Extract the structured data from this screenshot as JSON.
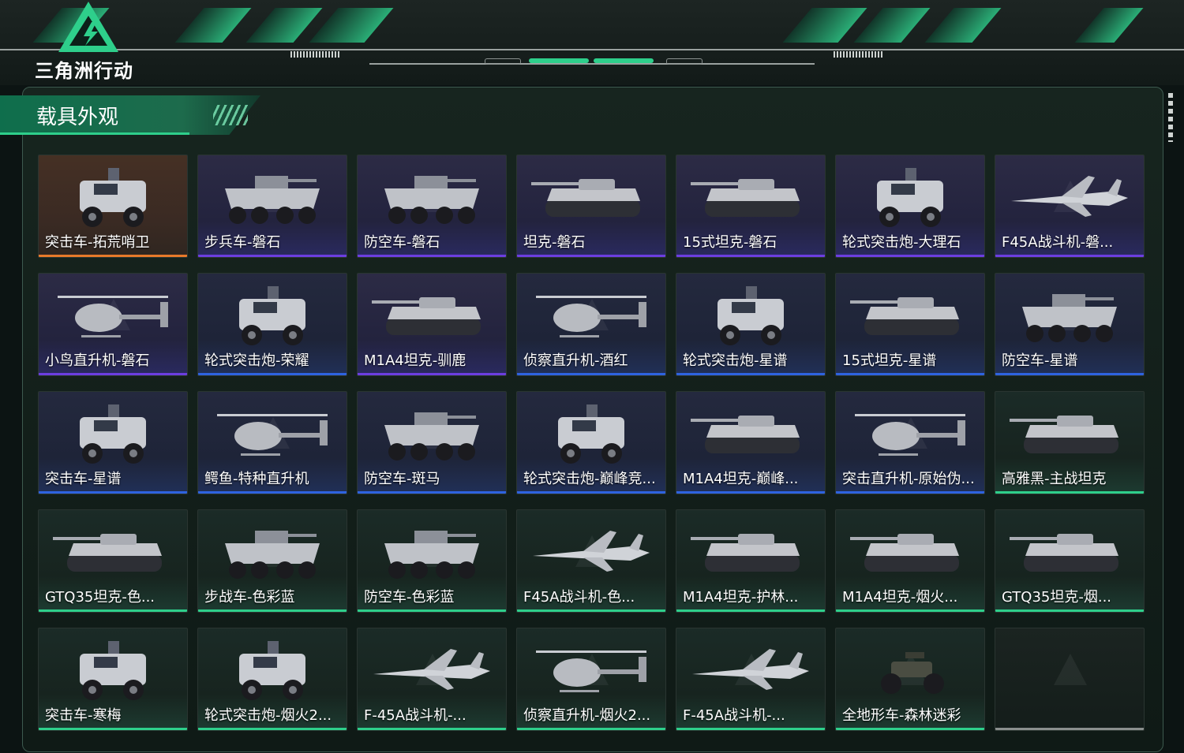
{
  "brand": {
    "title": "三角洲行动"
  },
  "section": {
    "title": "载具外观"
  },
  "colors": {
    "accent": "#2ecf8b",
    "purple": "#6c3ee0",
    "blue": "#2e63e0",
    "green": "#2ecf8b",
    "orange": "#e87a2a",
    "empty": "#8a8f8d"
  },
  "cards": [
    {
      "name": "突击车-拓荒哨卫",
      "rarity": "orange",
      "icon": "armored-car"
    },
    {
      "name": "步兵车-磐石",
      "rarity": "purple",
      "icon": "wheeled-apc"
    },
    {
      "name": "防空车-磐石",
      "rarity": "purple",
      "icon": "wheeled-apc"
    },
    {
      "name": "坦克-磐石",
      "rarity": "purple",
      "icon": "tank"
    },
    {
      "name": "15式坦克-磐石",
      "rarity": "purple",
      "icon": "tank"
    },
    {
      "name": "轮式突击炮-大理石",
      "rarity": "purple",
      "icon": "armored-car"
    },
    {
      "name": "F45A战斗机-磐...",
      "rarity": "purple",
      "icon": "jet"
    },
    {
      "name": "小鸟直升机-磐石",
      "rarity": "purple",
      "icon": "helicopter"
    },
    {
      "name": "轮式突击炮-荣耀",
      "rarity": "blue",
      "icon": "armored-car"
    },
    {
      "name": "M1A4坦克-驯鹿",
      "rarity": "purple",
      "icon": "tank"
    },
    {
      "name": "侦察直升机-酒红",
      "rarity": "blue",
      "icon": "helicopter"
    },
    {
      "name": "轮式突击炮-星谱",
      "rarity": "blue",
      "icon": "armored-car"
    },
    {
      "name": "15式坦克-星谱",
      "rarity": "blue",
      "icon": "tank"
    },
    {
      "name": "防空车-星谱",
      "rarity": "blue",
      "icon": "wheeled-apc"
    },
    {
      "name": "突击车-星谱",
      "rarity": "blue",
      "icon": "armored-car"
    },
    {
      "name": "鳄鱼-特种直升机",
      "rarity": "blue",
      "icon": "helicopter"
    },
    {
      "name": "防空车-斑马",
      "rarity": "blue",
      "icon": "wheeled-apc"
    },
    {
      "name": "轮式突击炮-巅峰竞...",
      "rarity": "blue",
      "icon": "armored-car"
    },
    {
      "name": "M1A4坦克-巅峰...",
      "rarity": "blue",
      "icon": "tank"
    },
    {
      "name": "突击直升机-原始伪...",
      "rarity": "blue",
      "icon": "helicopter"
    },
    {
      "name": "高雅黑-主战坦克",
      "rarity": "green",
      "icon": "tank"
    },
    {
      "name": "GTQ35坦克-色...",
      "rarity": "green",
      "icon": "tank"
    },
    {
      "name": "步战车-色彩蓝",
      "rarity": "green",
      "icon": "wheeled-apc"
    },
    {
      "name": "防空车-色彩蓝",
      "rarity": "green",
      "icon": "wheeled-apc"
    },
    {
      "name": "F45A战斗机-色...",
      "rarity": "green",
      "icon": "jet"
    },
    {
      "name": "M1A4坦克-护林...",
      "rarity": "green",
      "icon": "tank"
    },
    {
      "name": "M1A4坦克-烟火...",
      "rarity": "green",
      "icon": "tank"
    },
    {
      "name": "GTQ35坦克-烟...",
      "rarity": "green",
      "icon": "tank"
    },
    {
      "name": "突击车-寒梅",
      "rarity": "green",
      "icon": "armored-car"
    },
    {
      "name": "轮式突击炮-烟火2...",
      "rarity": "green",
      "icon": "armored-car"
    },
    {
      "name": "F-45A战斗机-...",
      "rarity": "green",
      "icon": "jet"
    },
    {
      "name": "侦察直升机-烟火2...",
      "rarity": "green",
      "icon": "helicopter"
    },
    {
      "name": "F-45A战斗机-...",
      "rarity": "green",
      "icon": "jet"
    },
    {
      "name": "全地形车-森林迷彩",
      "rarity": "green",
      "icon": "atv"
    },
    {
      "name": "",
      "rarity": "grey",
      "icon": "empty-slot"
    }
  ]
}
